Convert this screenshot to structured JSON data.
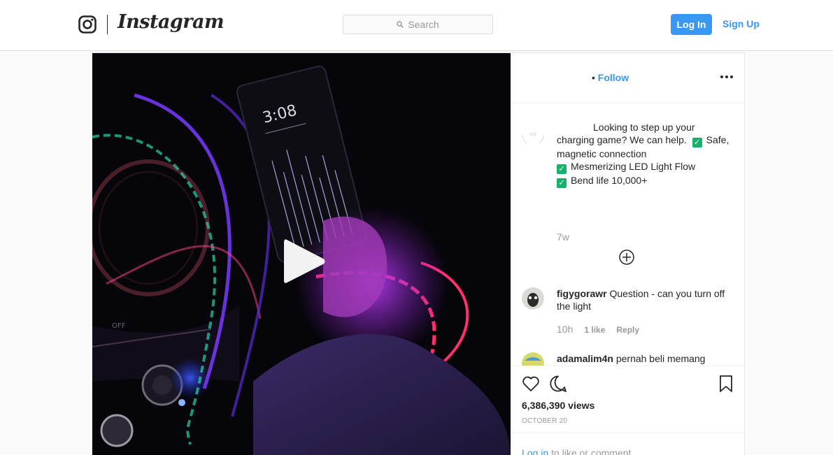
{
  "header": {
    "logo_text": "Instagram",
    "search_placeholder": "Search",
    "login_label": "Log In",
    "signup_label": "Sign Up"
  },
  "post": {
    "dot": "•",
    "follow_label": "Follow",
    "caption": {
      "line1": "Looking to step up your",
      "line2": "charging game? We can help.",
      "safe": "Safe,",
      "line3": "magnetic connection",
      "item2": "Mesmerizing LED Light Flow",
      "item3": "Bend life 10,000+",
      "check": "✓"
    },
    "caption_time": "7w",
    "comments": [
      {
        "username": "figygorawr",
        "text": "Question - can you turn off the light",
        "time": "10h",
        "likes": "1 like",
        "reply": "Reply"
      },
      {
        "username": "adamalim4n",
        "text": "pernah beli memang"
      }
    ],
    "views": "6,386,390 views",
    "date": "OCTOBER 20",
    "login_link": "Log in",
    "login_suffix": "to like or comment."
  },
  "colors": {
    "accent": "#3897f0",
    "border": "#dbdbdb",
    "muted": "#999999",
    "text": "#262626"
  },
  "icons": [
    "instagram-glyph-icon",
    "search-icon",
    "play-icon",
    "more-options-icon",
    "add-comment-icon",
    "heart-icon",
    "comment-icon",
    "bookmark-icon"
  ]
}
